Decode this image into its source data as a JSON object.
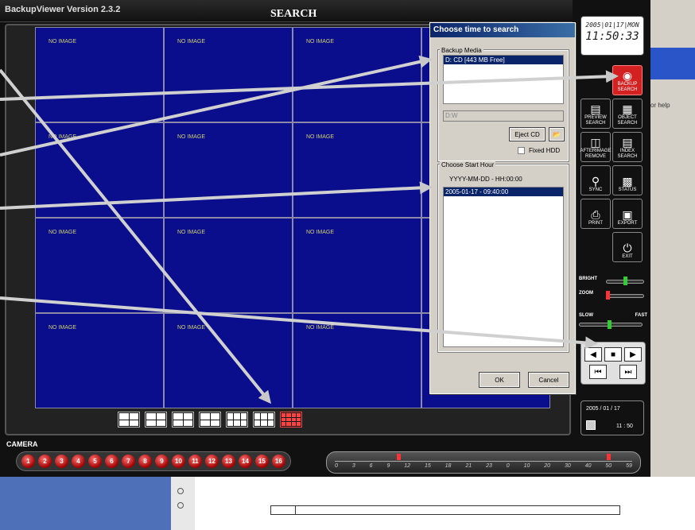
{
  "app": {
    "version": "BackupViewer Version 2.3.2",
    "mode_title": "SEARCH"
  },
  "grid": {
    "cell_label": "NO IMAGE"
  },
  "camera": {
    "label": "CAMERA",
    "buttons": [
      "1",
      "2",
      "3",
      "4",
      "5",
      "6",
      "7",
      "8",
      "9",
      "10",
      "11",
      "12",
      "13",
      "14",
      "15",
      "16"
    ]
  },
  "timeline": {
    "hours": [
      "0",
      "3",
      "6",
      "9",
      "12",
      "15",
      "18",
      "21",
      "23",
      "0",
      "10",
      "20",
      "30",
      "40",
      "50",
      "59"
    ]
  },
  "side": {
    "clock_date": "2005|01|17|MON",
    "clock_time": "11:50:33",
    "backup_search": "BACKUP SEARCH",
    "preview_search": "PREVIEW SEARCH",
    "object_search": "OBJECT SEARCH",
    "afterimage_remove": "AFTERIMAGE REMOVE",
    "index_search": "INDEX SEARCH",
    "sync": "SYNC",
    "status": "STATUS",
    "print": "PRINT",
    "export": "EXPORT",
    "exit": "EXIT",
    "bright": "BRIGHT",
    "zoom": "ZOOM",
    "slow": "SLOW",
    "fast": "FAST",
    "date": "2005 /  01 /  17",
    "time": "11 :  50"
  },
  "dialog": {
    "title": "Choose time to search",
    "backup_media_label": "Backup Media",
    "media_item": "D: CD [443 MB Free]",
    "drive_field": "D:W",
    "eject_label": "Eject CD",
    "fixed_hdd": "Fixed HDD",
    "start_hour_label": "Choose Start Hour",
    "format_hint": "YYYY-MM-DD - HH:00:00",
    "hour_item": "2005-01-17 - 09:40:00",
    "ok_label": "OK",
    "cancel_label": "Cancel"
  },
  "background": {
    "help_text": "or help"
  },
  "colors": {
    "grid_bg": "#0a0e8c",
    "accent_red": "#d32020",
    "highlight": "#0a246a"
  }
}
